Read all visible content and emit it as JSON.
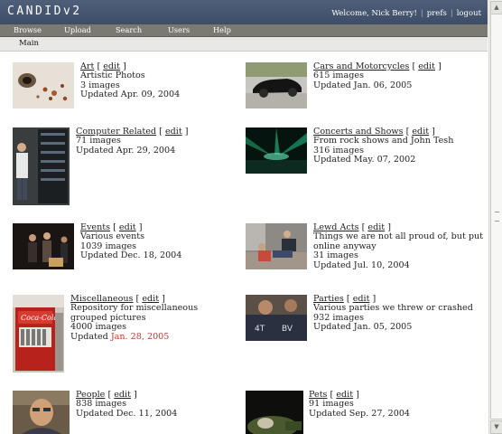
{
  "app": {
    "title": "CANDIDv2"
  },
  "user": {
    "welcome": "Welcome, Nick Berry!",
    "prefs": "prefs",
    "logout": "logout"
  },
  "menu": [
    "Browse",
    "Upload",
    "Search",
    "Users",
    "Help"
  ],
  "breadcrumb": "Main",
  "edit_label": "edit",
  "albums": [
    {
      "title": "Art",
      "lines": [
        "Artistic Photos"
      ],
      "count": "3 images",
      "updated": "Updated Apr. 09, 2004"
    },
    {
      "title": "Cars and Motorcycles",
      "lines": [],
      "count": "615 images",
      "updated": "Updated Jan. 06, 2005"
    },
    {
      "title": "Computer Related",
      "lines": [],
      "count": "71 images",
      "updated": "Updated Apr. 29, 2004"
    },
    {
      "title": "Concerts and Shows",
      "lines": [
        "From rock shows and John Tesh"
      ],
      "count": "316 images",
      "updated": "Updated May. 07, 2002"
    },
    {
      "title": "Events",
      "lines": [
        "Various events"
      ],
      "count": "1039 images",
      "updated": "Updated Dec. 18, 2004"
    },
    {
      "title": "Lewd Acts",
      "lines": [
        "Things we are not all proud of, but put",
        "online anyway"
      ],
      "count": "31 images",
      "updated": "Updated Jul. 10, 2004"
    },
    {
      "title": "Miscellaneous",
      "lines": [
        "Repository for miscellaneous",
        "grouped pictures"
      ],
      "count": "4000 images",
      "updated_prefix": "Updated ",
      "updated_date": "Jan. 28, 2005"
    },
    {
      "title": "Parties",
      "lines": [
        "Various parties we threw or crashed"
      ],
      "count": "932 images",
      "updated": "Updated Jan. 05, 2005"
    },
    {
      "title": "People",
      "lines": [],
      "count": "838 images",
      "updated": "Updated Dec. 11, 2004"
    },
    {
      "title": "Pets",
      "lines": [],
      "count": "91 images",
      "updated": "Updated Sep. 27, 2004"
    }
  ],
  "colors": {
    "header": "#4f5f79",
    "menubar": "#7b7a72",
    "new_date": "#b53a36"
  }
}
